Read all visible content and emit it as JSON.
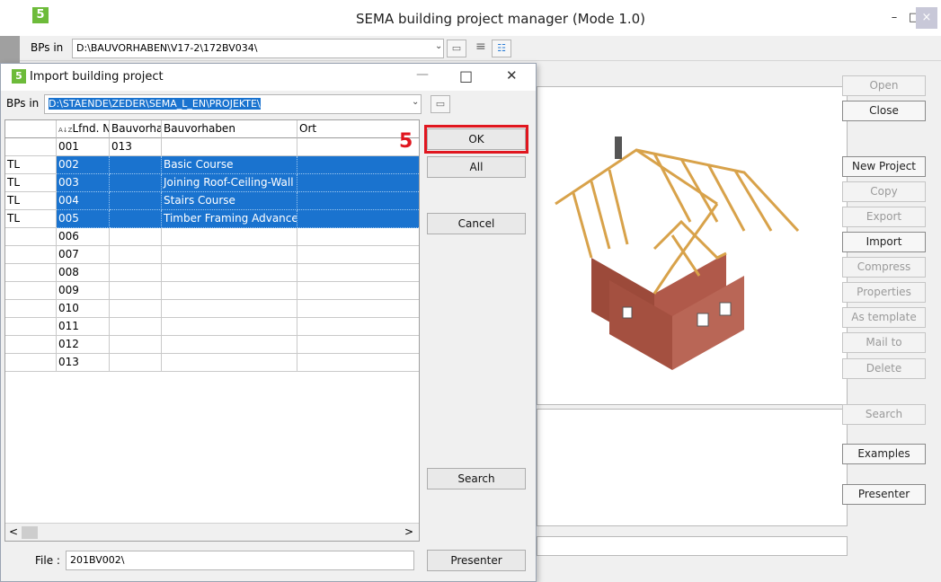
{
  "main_window": {
    "title": "SEMA building project manager  (Mode 1.0)",
    "logo_letter": "5",
    "minimize_glyph": "–",
    "maximize_glyph": "□",
    "close_glyph": "×",
    "bps_label": "BPs in",
    "bps_path": "D:\\BAUVORHABEN\\V17-2\\172BV034\\",
    "side_buttons": {
      "open": "Open",
      "close": "Close",
      "new_project": "New Project",
      "copy": "Copy",
      "export": "Export",
      "import": "Import",
      "compress": "Compress",
      "properties": "Properties",
      "as_template": "As template",
      "mail_to": "Mail to",
      "delete": "Delete",
      "search": "Search",
      "examples": "Examples",
      "presenter": "Presenter"
    }
  },
  "dialog": {
    "title": "Import building project",
    "logo_letter": "5",
    "minimize_glyph": "—",
    "maximize_glyph": "□",
    "close_glyph": "✕",
    "bps_label": "BPs in",
    "bps_path": "D:\\STAENDE\\ZEDER\\SEMA_L_EN\\PROJEKTE\\",
    "step_number": "5",
    "columns": {
      "sort": "A↓Z",
      "lfnd": "Lfnd. N",
      "bv_short": "Bauvorhal",
      "bv": "Bauvorhaben",
      "ort": "Ort"
    },
    "rows": [
      {
        "tag": "",
        "lfnd": "001",
        "short": "013",
        "name": "",
        "ort": "",
        "selected": false
      },
      {
        "tag": "TL",
        "lfnd": "002",
        "short": "",
        "name": "Basic Course",
        "ort": "",
        "selected": true
      },
      {
        "tag": "TL",
        "lfnd": "003",
        "short": "",
        "name": "Joining Roof-Ceiling-Wall .",
        "ort": "",
        "selected": true
      },
      {
        "tag": "TL",
        "lfnd": "004",
        "short": "",
        "name": "Stairs Course",
        "ort": "",
        "selected": true
      },
      {
        "tag": "TL",
        "lfnd": "005",
        "short": "",
        "name": "Timber Framing Advanced",
        "ort": "",
        "selected": true
      },
      {
        "tag": "",
        "lfnd": "006",
        "short": "",
        "name": "",
        "ort": "",
        "selected": false
      },
      {
        "tag": "",
        "lfnd": "007",
        "short": "",
        "name": "",
        "ort": "",
        "selected": false
      },
      {
        "tag": "",
        "lfnd": "008",
        "short": "",
        "name": "",
        "ort": "",
        "selected": false
      },
      {
        "tag": "",
        "lfnd": "009",
        "short": "",
        "name": "",
        "ort": "",
        "selected": false
      },
      {
        "tag": "",
        "lfnd": "010",
        "short": "",
        "name": "",
        "ort": "",
        "selected": false
      },
      {
        "tag": "",
        "lfnd": "011",
        "short": "",
        "name": "",
        "ort": "",
        "selected": false
      },
      {
        "tag": "",
        "lfnd": "012",
        "short": "",
        "name": "",
        "ort": "",
        "selected": false
      },
      {
        "tag": "",
        "lfnd": "013",
        "short": "",
        "name": "",
        "ort": "",
        "selected": false
      }
    ],
    "buttons": {
      "ok": "OK",
      "all": "All",
      "cancel": "Cancel",
      "search": "Search",
      "presenter": "Presenter"
    },
    "file_label": "File :",
    "file_value": "201BV002\\",
    "scroll_left": "<",
    "scroll_right": ">"
  },
  "colors": {
    "selection": "#1a73cf",
    "highlight": "#e0161f",
    "logo": "#6dbb3a"
  }
}
